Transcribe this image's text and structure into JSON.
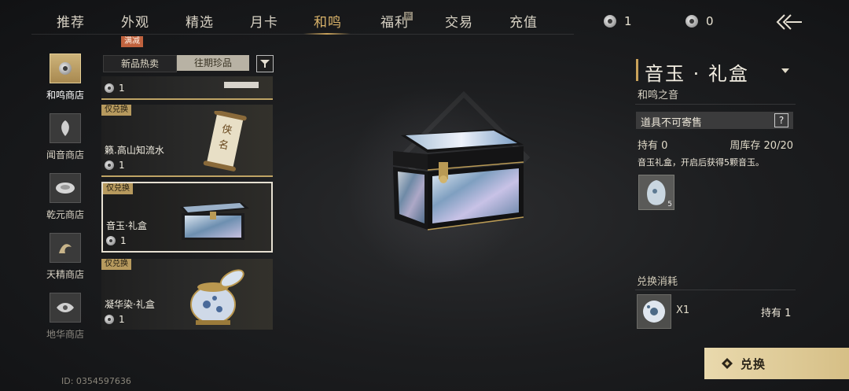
{
  "nav": {
    "tabs": [
      "推荐",
      "外观",
      "精选",
      "月卡",
      "和鸣",
      "福利",
      "交易",
      "充值"
    ],
    "active_tab": "和鸣",
    "promo_badge": "满减",
    "new_badge": "新",
    "currencies": [
      {
        "icon": "coin-icon",
        "value": "1"
      },
      {
        "icon": "coin-icon",
        "value": "0"
      }
    ]
  },
  "stores": [
    {
      "label": "和鸣商店",
      "active": true
    },
    {
      "label": "闻音商店",
      "active": false
    },
    {
      "label": "乾元商店",
      "active": false
    },
    {
      "label": "天精商店",
      "active": false
    },
    {
      "label": "地华商店",
      "active": false
    }
  ],
  "subtabs": {
    "new_hot": "新品热卖",
    "past": "往期珍品"
  },
  "items": [
    {
      "name": "",
      "price": "1",
      "tag": ""
    },
    {
      "name": "籁.高山知流水",
      "price": "1",
      "tag": "仅兑换"
    },
    {
      "name": "音玉·礼盒",
      "price": "1",
      "tag": "仅兑换"
    },
    {
      "name": "凝华染·礼盒",
      "price": "1",
      "tag": "仅兑换"
    }
  ],
  "detail": {
    "title": "音玉 · 礼盒",
    "subtitle": "和鸣之音",
    "notice": "道具不可寄售",
    "help": "?",
    "owned": "持有 0",
    "stock": "周库存 20/20",
    "description": "音玉礼盒，开启后获得5颗音玉。",
    "reward_count": "5",
    "cost_label": "兑换消耗",
    "cost_multiplier": "X1",
    "cost_owned": "持有 1",
    "exchange_button": "兑换"
  },
  "uid": "ID: 0354597636",
  "colors": {
    "accent": "#c9a25a",
    "button": "#e3d2a4"
  }
}
